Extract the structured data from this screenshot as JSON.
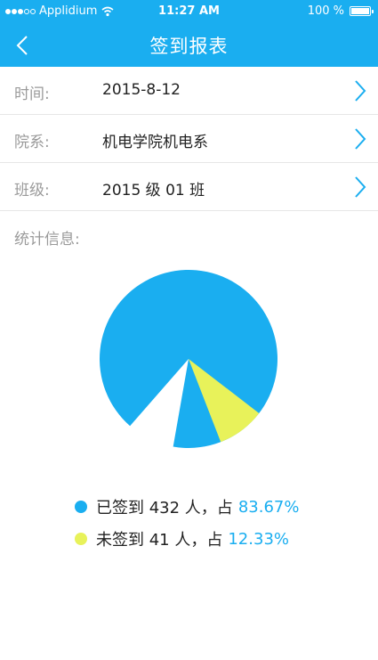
{
  "status_bar": {
    "carrier": "Applidium",
    "time": "11:27 AM",
    "battery": "100 %"
  },
  "nav": {
    "title": "签到报表",
    "back_icon": "chevron-left-icon"
  },
  "fields": [
    {
      "label": "时间:",
      "value": "2015-8-12"
    },
    {
      "label": "院系:",
      "value": "机电学院机电系"
    },
    {
      "label": "班级:",
      "value": "2015 级 01 班"
    }
  ],
  "stats": {
    "label": "统计信息:"
  },
  "colors": {
    "accent": "#1aaef0",
    "signed": "#1aaef0",
    "unsigned": "#e8f25a"
  },
  "chart_data": {
    "type": "pie",
    "labels": [
      "已签到",
      "未签到"
    ],
    "values": [
      432,
      41
    ],
    "percentages": [
      83.67,
      12.33
    ],
    "colors": [
      "#1aaef0",
      "#e8f25a"
    ]
  },
  "legend": [
    {
      "text": "已签到 432 人，占",
      "pct": "83.67%"
    },
    {
      "text": "未签到 41 人，占",
      "pct": "12.33%"
    }
  ]
}
